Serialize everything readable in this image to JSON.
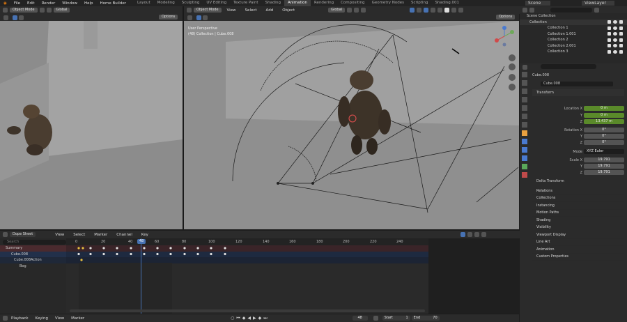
{
  "topbar": {
    "menus": [
      "File",
      "Edit",
      "Render",
      "Window",
      "Help",
      "Home Builder"
    ],
    "workspaces": [
      "Layout",
      "Modeling",
      "Sculpting",
      "UV Editing",
      "Texture Paint",
      "Shading",
      "Animation",
      "Rendering",
      "Compositing",
      "Geometry Nodes",
      "Scripting",
      "Shading.001"
    ],
    "active_workspace": "Animation",
    "scene": "Scene",
    "view_layer": "ViewLayer"
  },
  "viewport_left": {
    "mode": "Object Mode",
    "options": "Options"
  },
  "viewport_main": {
    "mode": "Object Mode",
    "menus": [
      "View",
      "Select",
      "Add",
      "Object"
    ],
    "orientation": "Global",
    "options": "Options",
    "overlay_title": "User Perspective",
    "overlay_subtitle": "(48) Collection | Cube.008"
  },
  "outliner": {
    "search_placeholder": "",
    "root": "Scene Collection",
    "collection": "Collection",
    "children": [
      "Collection 1",
      "Collection 1.001",
      "Collection 2",
      "Collection 2.001",
      "Collection 3"
    ]
  },
  "properties": {
    "object_name": "Cube.008",
    "object_name2": "Cube.008",
    "transform_header": "Transform",
    "location_label": "Location X",
    "loc": {
      "x": "0 m",
      "y": "0 m",
      "z": "13.437 m"
    },
    "rotation_label": "Rotation X",
    "rot": {
      "x": "0°",
      "y": "0°",
      "z": "0°"
    },
    "mode_label": "Mode",
    "mode_value": "XYZ Euler",
    "scale_label": "Scale X",
    "scale": {
      "x": "19.791",
      "y": "19.791",
      "z": "19.791"
    },
    "axis_y": "Y",
    "axis_z": "Z",
    "delta": "Delta Transform",
    "sections": [
      "Relations",
      "Collections",
      "Instancing",
      "Motion Paths",
      "Shading",
      "Visibility",
      "Viewport Display",
      "Line Art",
      "Animation",
      "Custom Properties"
    ]
  },
  "dopesheet": {
    "editor": "Dope Sheet",
    "menus": [
      "View",
      "Select",
      "Marker",
      "Channel",
      "Key"
    ],
    "search_placeholder": "Search",
    "channels": [
      "Summary",
      "Cube.008",
      "Cube.008Action",
      "Bog"
    ],
    "ticks": [
      "0",
      "20",
      "40",
      "48",
      "60",
      "80",
      "100",
      "120",
      "140",
      "160",
      "180",
      "200",
      "220",
      "240"
    ],
    "current_frame": "48"
  },
  "playback": {
    "playback": "Playback",
    "keying": "Keying",
    "view": "View",
    "marker": "Marker",
    "frame": "48",
    "start_label": "Start",
    "start": "1",
    "end_label": "End",
    "end": "70"
  },
  "colors": {
    "accent": "#4772b3",
    "green_field": "#5a8a2a",
    "summary_row": "#4a2a2e",
    "object_row": "#22304a",
    "playhead": "#4772b3"
  }
}
